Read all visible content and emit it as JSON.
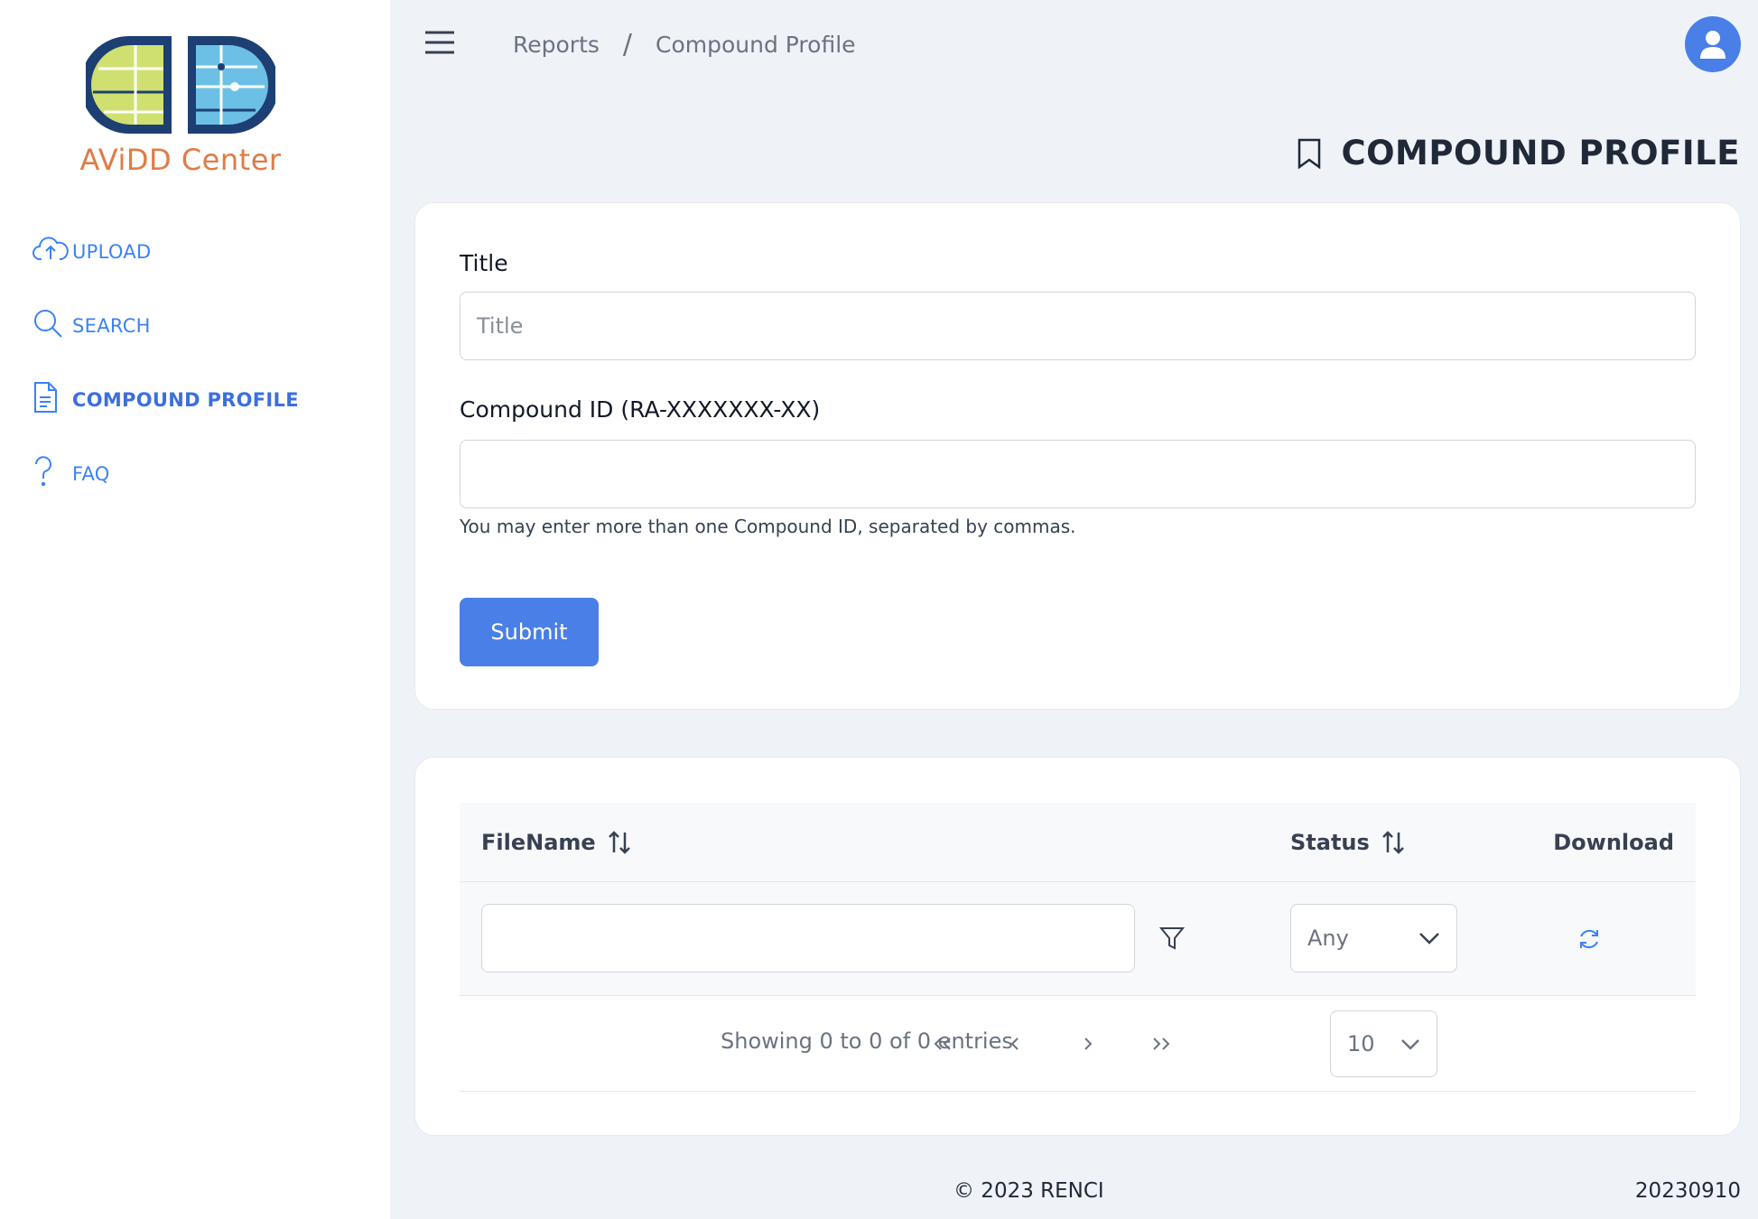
{
  "sidebar": {
    "logo_text": "AViDD Center",
    "items": [
      {
        "label": "UPLOAD",
        "icon": "cloud-upload-icon"
      },
      {
        "label": "SEARCH",
        "icon": "search-icon"
      },
      {
        "label": "COMPOUND PROFILE",
        "icon": "file-icon",
        "active": true
      },
      {
        "label": "FAQ",
        "icon": "question-icon"
      }
    ]
  },
  "header": {
    "breadcrumb": [
      "Reports",
      "Compound Profile"
    ],
    "breadcrumb_sep": "/",
    "page_title": "COMPOUND PROFILE"
  },
  "form": {
    "title_label": "Title",
    "title_placeholder": "Title",
    "title_value": "",
    "compound_label": "Compound ID (RA-XXXXXXX-XX)",
    "compound_value": "",
    "hint": "You may enter more than one Compound ID, separated by commas.",
    "submit_label": "Submit"
  },
  "table": {
    "columns": [
      "FileName",
      "Status",
      "Download"
    ],
    "status_filter": "Any",
    "page_info": "Showing 0 to 0 of 0 entries",
    "rows_per_page": "10",
    "rows": []
  },
  "footer": {
    "copyright": "© 2023 RENCI",
    "version": "20230910"
  },
  "colors": {
    "accent": "#4a7fe8",
    "brand_orange": "#e07b45",
    "nav_blue": "#3b82f6"
  }
}
